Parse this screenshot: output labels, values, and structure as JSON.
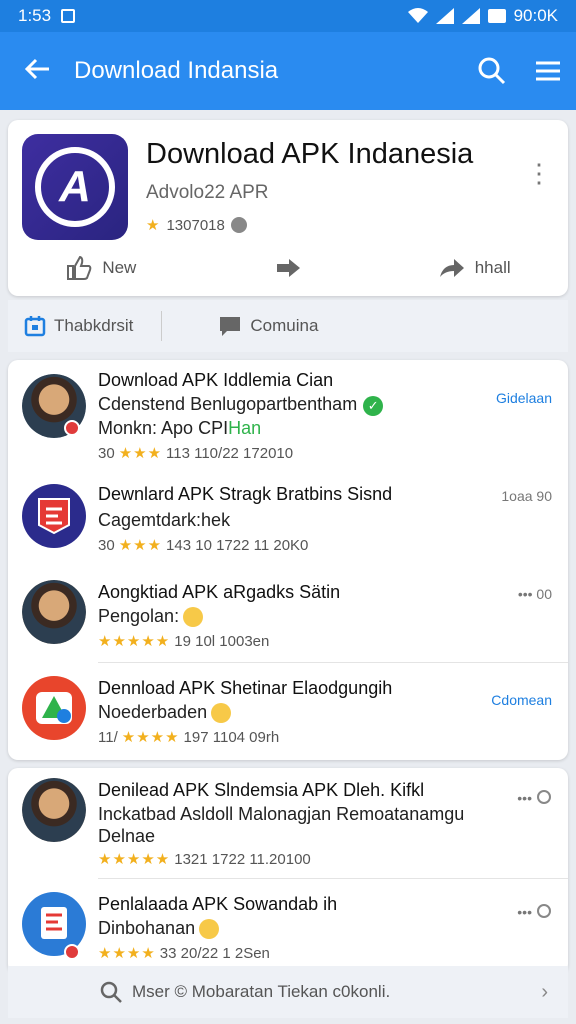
{
  "status": {
    "time": "1:53",
    "battery": "90:0K"
  },
  "app_bar": {
    "title": "Download Indansia"
  },
  "hero": {
    "title": "Download APK Indanesia",
    "subtitle": "Advolo22 APR",
    "rating": "1307018",
    "actions": [
      {
        "label": "New",
        "icon": "thumbs-up-icon"
      },
      {
        "label": "",
        "icon": "share-icon"
      },
      {
        "label": "hhall",
        "icon": "forward-icon"
      }
    ]
  },
  "tabs": [
    {
      "label": "Thabkdrsit",
      "icon": "calendar-icon"
    },
    {
      "label": "Comuina",
      "icon": "comment-icon"
    }
  ],
  "list1": [
    {
      "line1": "Download APK Iddlemia Cian",
      "line2": "Cdenstend Benlugopartbentham",
      "line3_a": "Monkn: Apo CPI",
      "line3_hl": "Han",
      "meta_prefix": "30",
      "meta": "113 110/22 172010",
      "side": "Gidelaan"
    },
    {
      "line1": "Dewnlard APK Stragk Bratbins Sisnd",
      "line2": "Cagemtdark:hek",
      "meta_prefix": "30",
      "meta": "143 10 1722 11 20K0",
      "side": "1oaa 90"
    },
    {
      "line1": "Aongktiad  APK aRgadks Sätin",
      "line2": "Pengolan:",
      "meta": "19 10l 1003en",
      "side": "••• 00"
    },
    {
      "line1": "Dennload APK Shetinar Elaodgungih",
      "line2": "Noederbaden",
      "meta_prefix": "11/",
      "meta": "197 1104 09rh",
      "side": "Cdomean"
    }
  ],
  "list2": [
    {
      "line1": "Denilead  APK Slndemsia APK Dleh. Kifkl",
      "line2": "Inckatbad Asldoll Malonagjan Remoatanamgu",
      "line3": "Delnae",
      "meta": "1321 1722 11.20100",
      "side": "••• "
    },
    {
      "line1": "Penlalaada APK Sowandab ih",
      "line2": "Dinbohanan",
      "meta": "33 20/22 1 2Sen",
      "side": "••• "
    }
  ],
  "bottom_bar": {
    "text": "Mser © Mobaratan Tiekan c0konli."
  },
  "colors": {
    "accent": "#2a8bf0",
    "star": "#f2b01e",
    "green": "#2fb34b"
  }
}
